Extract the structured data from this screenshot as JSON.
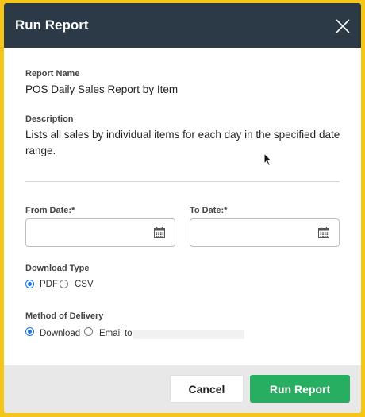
{
  "dialog": {
    "title": "Run Report",
    "close_icon": "close-icon"
  },
  "report": {
    "name_label": "Report Name",
    "name_value": "POS Daily Sales Report by Item",
    "description_label": "Description",
    "description_value": "Lists all sales by individual items for each day in the specified date range."
  },
  "dates": {
    "from_label": "From Date:*",
    "from_value": "",
    "to_label": "To Date:*",
    "to_value": "",
    "calendar_icon": "calendar-icon"
  },
  "download_type": {
    "label": "Download Type",
    "options": [
      {
        "label": "PDF",
        "checked": true
      },
      {
        "label": "CSV",
        "checked": false
      }
    ]
  },
  "delivery": {
    "label": "Method of Delivery",
    "options": [
      {
        "label": "Download",
        "checked": true
      },
      {
        "label": "Email to",
        "checked": false
      }
    ]
  },
  "footer": {
    "cancel_label": "Cancel",
    "run_label": "Run Report"
  },
  "colors": {
    "header_bg": "#2b3a46",
    "primary_button": "#27ae60",
    "page_bg": "#f5c518",
    "radio_accent": "#1a73e8"
  }
}
